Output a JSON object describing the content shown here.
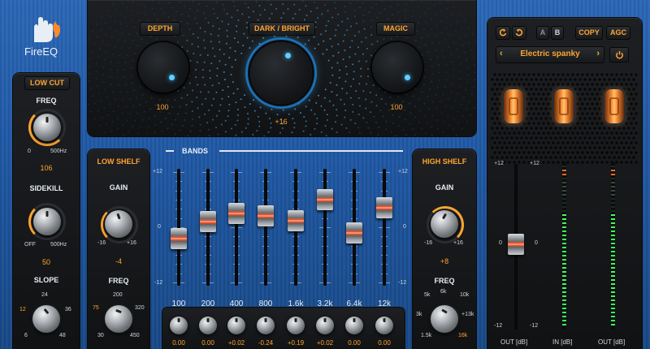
{
  "brand": {
    "name": "FireEQ",
    "logo": "flame-hand-logo"
  },
  "top": {
    "depth": {
      "label": "DEPTH",
      "value": "100"
    },
    "dark_bright": {
      "label": "DARK / BRIGHT",
      "value": "+16"
    },
    "magic": {
      "label": "MAGIC",
      "value": "100"
    }
  },
  "low_cut": {
    "title": "LOW CUT",
    "freq_label": "FREQ",
    "freq_min": "0",
    "freq_max": "500Hz",
    "freq_value": "106",
    "sidekill_label": "SIDEKILL",
    "sidekill_min": "OFF",
    "sidekill_max": "500Hz",
    "sidekill_value": "50",
    "slope_label": "SLOPE",
    "slope_marks": [
      "24",
      "12",
      "36",
      "6",
      "48"
    ]
  },
  "low_shelf": {
    "title": "LOW SHELF",
    "gain_label": "GAIN",
    "gain_min": "-16",
    "gain_max": "+16",
    "gain_value": "-4",
    "freq_label": "FREQ",
    "freq_marks": [
      "200",
      "75",
      "320",
      "30",
      "450"
    ]
  },
  "bands": {
    "title": "BANDS",
    "scale": [
      "+12",
      "0",
      "-12"
    ],
    "items": [
      {
        "freq": "100",
        "value": "0.00",
        "level": -0.2
      },
      {
        "freq": "200",
        "value": "0.00",
        "level": 0.1
      },
      {
        "freq": "400",
        "value": "+0.02",
        "level": 0.25
      },
      {
        "freq": "800",
        "value": "-0.24",
        "level": 0.2
      },
      {
        "freq": "1.6k",
        "value": "+0.19",
        "level": 0.12
      },
      {
        "freq": "3.2k",
        "value": "+0.02",
        "level": 0.5
      },
      {
        "freq": "6.4k",
        "value": "0.00",
        "level": -0.1
      },
      {
        "freq": "12k",
        "value": "0.00",
        "level": 0.35
      }
    ]
  },
  "high_shelf": {
    "title": "HIGH SHELF",
    "gain_label": "GAIN",
    "gain_min": "-16",
    "gain_max": "+16",
    "gain_value": "+8",
    "freq_label": "FREQ",
    "freq_marks": [
      "5k",
      "6k",
      "10k",
      "3k",
      "+13k",
      "1.5k",
      "16k"
    ]
  },
  "right": {
    "undo": "undo-icon",
    "redo": "redo-icon",
    "a": "A",
    "b": "B",
    "copy": "COPY",
    "agc": "AGC",
    "preset": "Electric spanky",
    "power": "power-icon",
    "out_scale": [
      "+12",
      "+12",
      "0",
      "0",
      "-12",
      "-12"
    ],
    "out_label": "OUT [dB]",
    "in_label": "IN [dB]",
    "out2_label": "OUT [dB]"
  },
  "colors": {
    "accent": "#ffa530",
    "glow": "#39b7ff",
    "panel": "#141517",
    "background": "#1e57a3"
  }
}
